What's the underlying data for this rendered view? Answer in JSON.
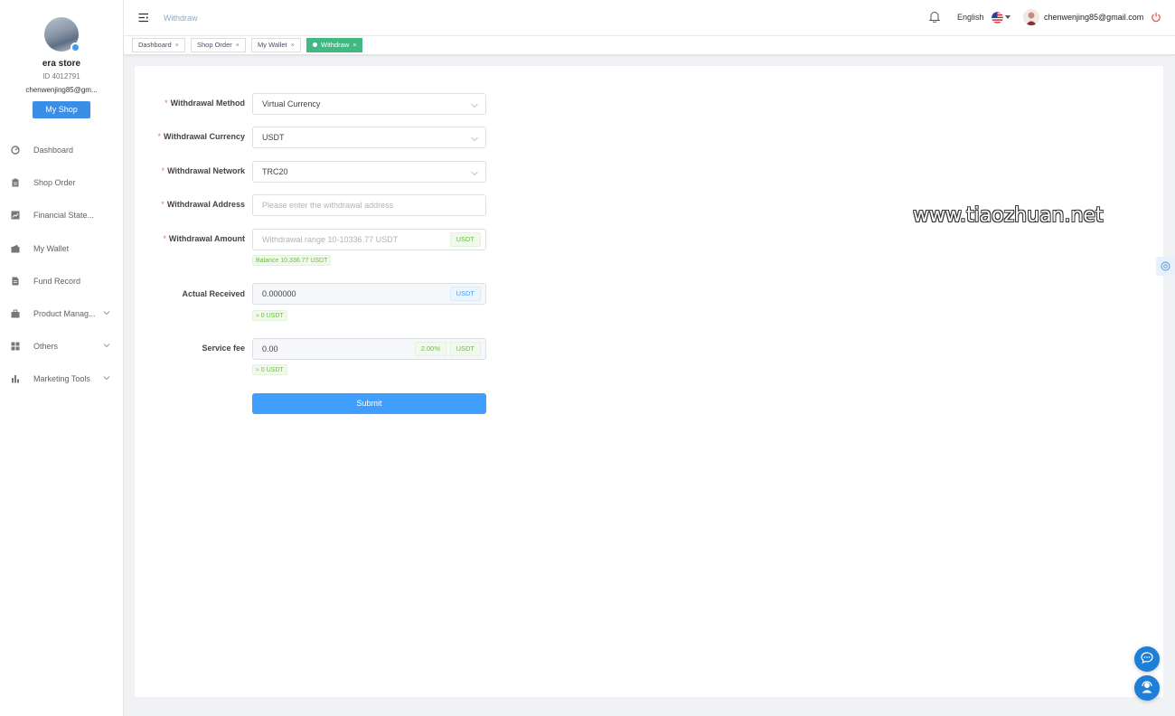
{
  "profile": {
    "store_name": "era store",
    "store_id": "ID 4012791",
    "email": "chenwenjing85@gm...",
    "myshop_label": "My Shop"
  },
  "sidebar": {
    "items": [
      {
        "label": "Dashboard",
        "icon": "dashboard-icon"
      },
      {
        "label": "Shop Order",
        "icon": "clipboard-icon"
      },
      {
        "label": "Financial State...",
        "icon": "chart-icon"
      },
      {
        "label": "My Wallet",
        "icon": "wallet-icon"
      },
      {
        "label": "Fund Record",
        "icon": "document-icon"
      },
      {
        "label": "Product Manag...",
        "icon": "briefcase-icon",
        "expandable": true
      },
      {
        "label": "Others",
        "icon": "grid-icon",
        "expandable": true
      },
      {
        "label": "Marketing Tools",
        "icon": "bar-chart-icon",
        "expandable": true
      }
    ]
  },
  "header": {
    "breadcrumb": "Withdraw",
    "language": "English",
    "user_email": "chenwenjing85@gmail.com"
  },
  "tags": [
    {
      "label": "Dashboard",
      "active": false
    },
    {
      "label": "Shop Order",
      "active": false
    },
    {
      "label": "My Wallet",
      "active": false
    },
    {
      "label": "Withdraw",
      "active": true
    }
  ],
  "form": {
    "method": {
      "label": "Withdrawal Method",
      "value": "Virtual Currency",
      "required": "*"
    },
    "currency": {
      "label": "Withdrawal Currency",
      "value": "USDT",
      "required": "*"
    },
    "network": {
      "label": "Withdrawal Network",
      "value": "TRC20",
      "required": "*"
    },
    "address": {
      "label": "Withdrawal Address",
      "placeholder": "Please enter the withdrawal address",
      "required": "*"
    },
    "amount": {
      "label": "Withdrawal Amount",
      "placeholder": "Withdrawal range 10-10336.77 USDT",
      "suffix": "USDT",
      "hint": "Balance 10,336.77 USDT",
      "required": "*"
    },
    "received": {
      "label": "Actual Received",
      "value": "0.000000",
      "suffix": "USDT",
      "hint": "≈ 0 USDT"
    },
    "fee": {
      "label": "Service fee",
      "value": "0.00",
      "rate": "2.00%",
      "suffix": "USDT",
      "hint": "≈ 0 USDT"
    },
    "submit_label": "Submit"
  },
  "watermark": "www.tiaozhuan.net",
  "colors": {
    "primary": "#409eff",
    "active_tag": "#42b983",
    "success": "#67c23a",
    "required": "#f56c6c"
  }
}
